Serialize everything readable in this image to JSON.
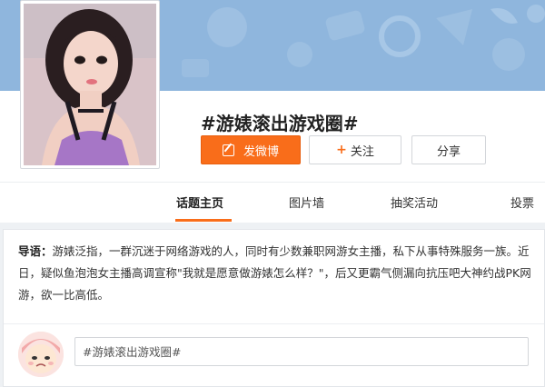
{
  "topic": {
    "title": "#游婊滚出游戏圈#"
  },
  "buttons": {
    "post_label": "发微博",
    "follow_label": "关注",
    "follow_prefix": "+",
    "share_label": "分享"
  },
  "tabs": [
    {
      "label": "话题主页",
      "active": true
    },
    {
      "label": "图片墙",
      "active": false
    },
    {
      "label": "抽奖活动",
      "active": false
    },
    {
      "label": "投票",
      "active": false
    }
  ],
  "intro": {
    "label": "导语：",
    "text": "游婊泛指，一群沉迷于网络游戏的人，同时有少数兼职网游女主播，私下从事特殊服务一族。近日，疑似鱼泡泡女主播高调宣称\"我就是愿意做游婊怎么样？\"，后又更霸气侧漏向抗压吧大神约战PK网游，欲一比高低。"
  },
  "comment": {
    "placeholder": "#游婊滚出游戏圈#"
  },
  "colors": {
    "accent": "#f96d1a",
    "banner": "#8fb6dd"
  },
  "icons": {
    "post": "edit-icon",
    "follow": "plus-icon"
  }
}
